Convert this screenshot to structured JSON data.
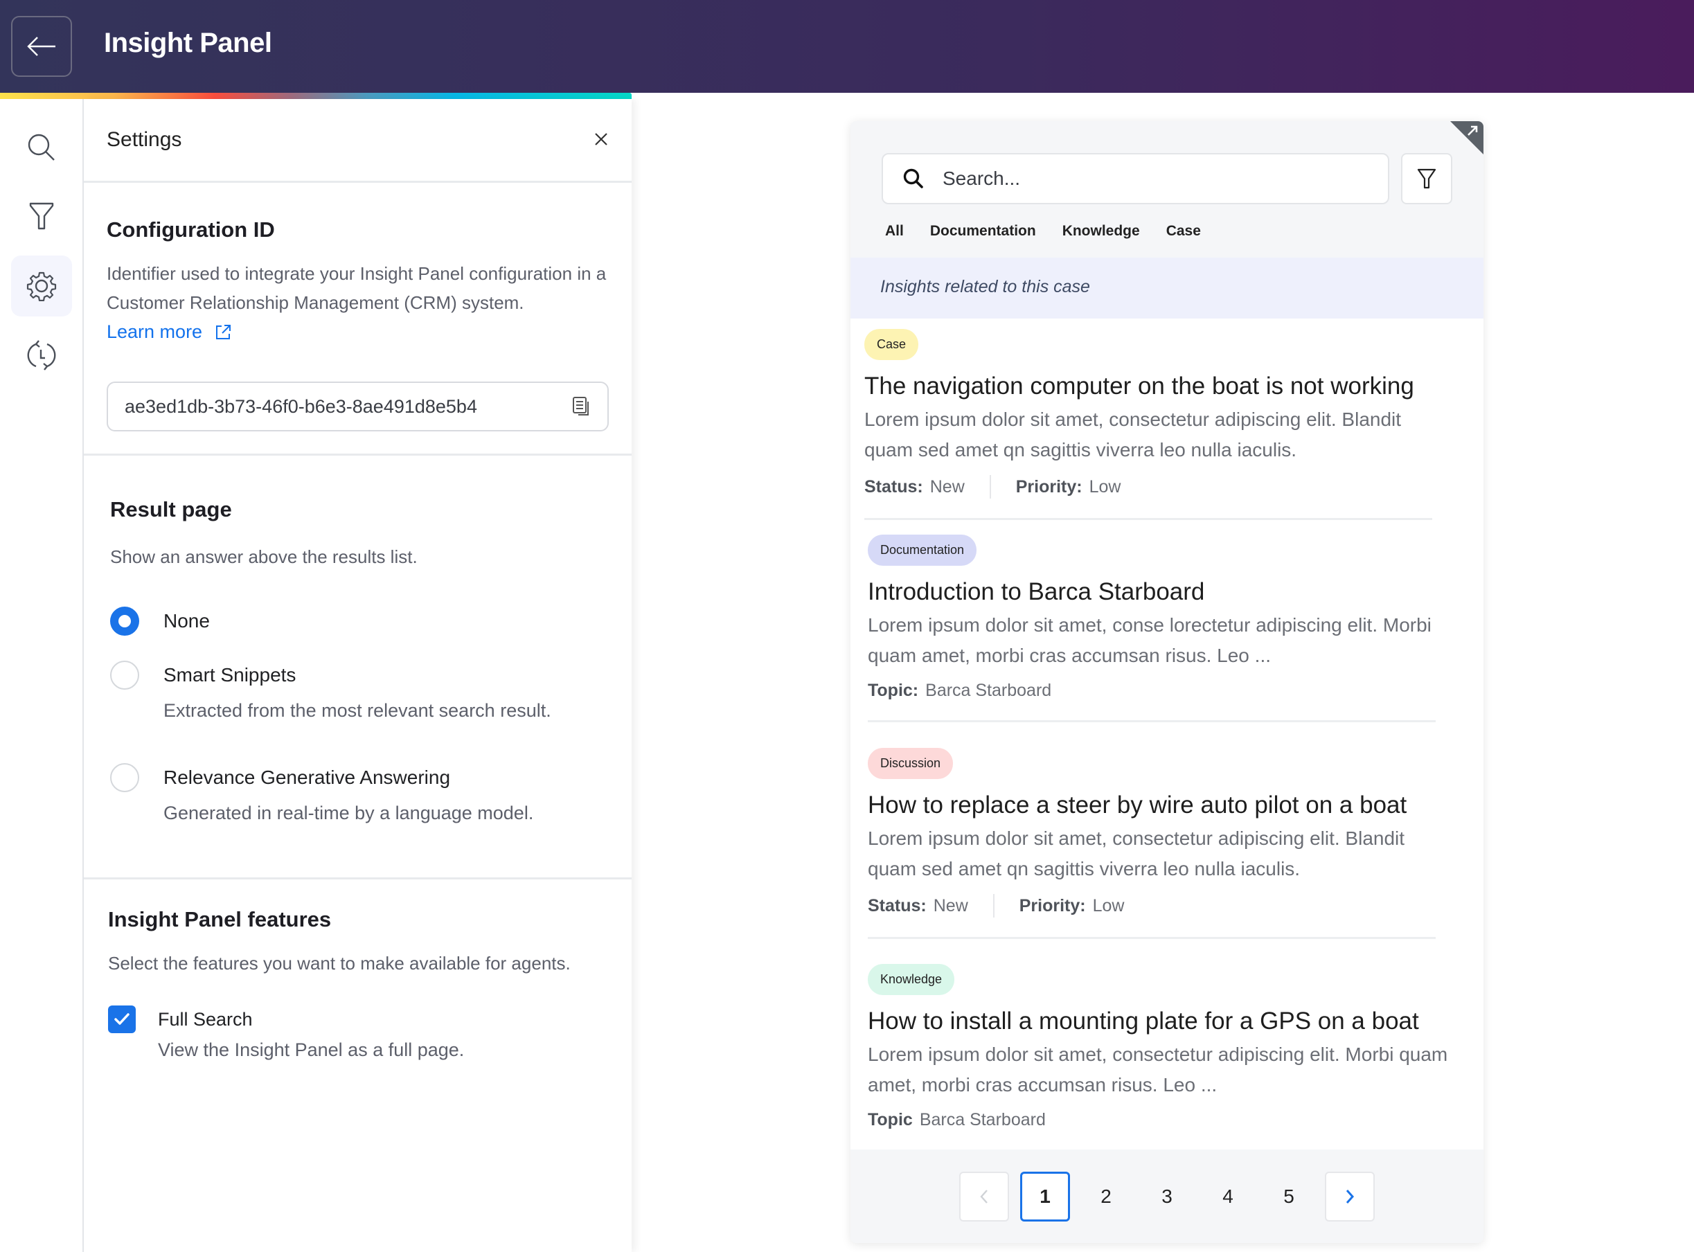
{
  "header": {
    "title": "Insight Panel",
    "back_icon": "arrow-left-icon"
  },
  "sidebar": {
    "items": [
      {
        "name": "search",
        "icon": "search-icon",
        "active": false
      },
      {
        "name": "filter",
        "icon": "filter-icon",
        "active": false
      },
      {
        "name": "settings",
        "icon": "gear-icon",
        "active": true
      },
      {
        "name": "history",
        "icon": "history-icon",
        "active": false
      }
    ]
  },
  "settings": {
    "title": "Settings",
    "configuration": {
      "title": "Configuration ID",
      "description": "Identifier used to integrate your Insight Panel configuration in a Customer Relationship Management (CRM) system.",
      "learn_more": "Learn more",
      "id_value": "ae3ed1db-3b73-46f0-b6e3-8ae491d8e5b4"
    },
    "result_page": {
      "title": "Result page",
      "description": "Show an answer above the results list.",
      "options": [
        {
          "label": "None",
          "description": "",
          "checked": true
        },
        {
          "label": "Smart Snippets",
          "description": "Extracted from the most relevant search result.",
          "checked": false
        },
        {
          "label": "Relevance Generative Answering",
          "description": "Generated in real-time by a language model.",
          "checked": false
        }
      ]
    },
    "features": {
      "title": "Insight Panel features",
      "description": "Select the features you want to make available for agents.",
      "items": [
        {
          "label": "Full Search",
          "description": "View the Insight Panel as a full page.",
          "checked": true
        }
      ]
    }
  },
  "preview": {
    "search": {
      "placeholder": "Search..."
    },
    "tabs": [
      {
        "label": "All",
        "active": true
      },
      {
        "label": "Documentation",
        "active": false
      },
      {
        "label": "Knowledge",
        "active": false
      },
      {
        "label": "Case",
        "active": false
      }
    ],
    "insights_label": "Insights related to this case",
    "results": [
      {
        "tag": "Case",
        "tag_color": "#fdf3b3",
        "title": "The navigation computer on the boat is not working",
        "excerpt": "Lorem ipsum dolor sit amet, consectetur adipiscing elit. Blandit quam sed amet qn sagittis viverra leo nulla iaculis.",
        "meta": [
          {
            "key": "Status:",
            "value": "New"
          },
          {
            "key": "Priority:",
            "value": "Low"
          }
        ]
      },
      {
        "tag": "Documentation",
        "tag_color": "#d6d9f7",
        "title": "Introduction to Barca Starboard",
        "excerpt": "Lorem ipsum dolor sit amet, conse  lorectetur adipiscing elit. Morbi quam amet, morbi cras accumsan risus. Leo ...",
        "meta": [
          {
            "key": "Topic:",
            "value": "Barca Starboard"
          }
        ]
      },
      {
        "tag": "Discussion",
        "tag_color": "#fdd9d9",
        "title": "How to replace a steer by wire auto pilot on a boat",
        "excerpt": "Lorem ipsum dolor sit amet, consectetur adipiscing elit. Blandit quam sed amet qn sagittis viverra leo nulla iaculis.",
        "meta": [
          {
            "key": "Status:",
            "value": "New"
          },
          {
            "key": "Priority:",
            "value": "Low"
          }
        ]
      },
      {
        "tag": "Knowledge",
        "tag_color": "#d9f7ea",
        "title": "How to install a mounting plate for a GPS on a boat",
        "excerpt": "Lorem ipsum dolor sit amet, consectetur adipiscing elit. Morbi quam amet, morbi cras accumsan risus. Leo ...",
        "meta": [
          {
            "key": "Topic",
            "value": "Barca Starboard"
          }
        ]
      }
    ],
    "pagination": {
      "pages": [
        "1",
        "2",
        "3",
        "4",
        "5"
      ],
      "current": "1"
    }
  },
  "colors": {
    "accent": "#1a73e8",
    "header_start": "#33345a",
    "header_end": "#4a1c5c"
  }
}
